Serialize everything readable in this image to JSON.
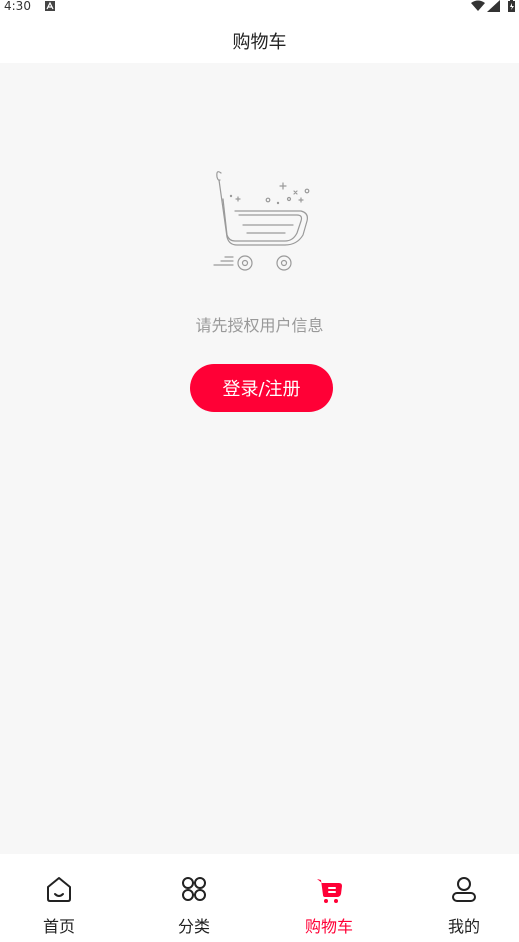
{
  "status_bar": {
    "time": "4:30"
  },
  "header": {
    "title": "购物车"
  },
  "empty_state": {
    "illustration": "shopping-cart-icon",
    "message": "请先授权用户信息",
    "login_label": "登录/注册"
  },
  "tabbar": {
    "items": [
      {
        "label": "首页",
        "icon": "home-icon",
        "active": false
      },
      {
        "label": "分类",
        "icon": "category-grid-icon",
        "active": false
      },
      {
        "label": "购物车",
        "icon": "cart-icon",
        "active": true
      },
      {
        "label": "我的",
        "icon": "user-icon",
        "active": false
      }
    ]
  },
  "colors": {
    "accent": "#ff0036",
    "background": "#f7f7f7",
    "muted_text": "#999999"
  }
}
